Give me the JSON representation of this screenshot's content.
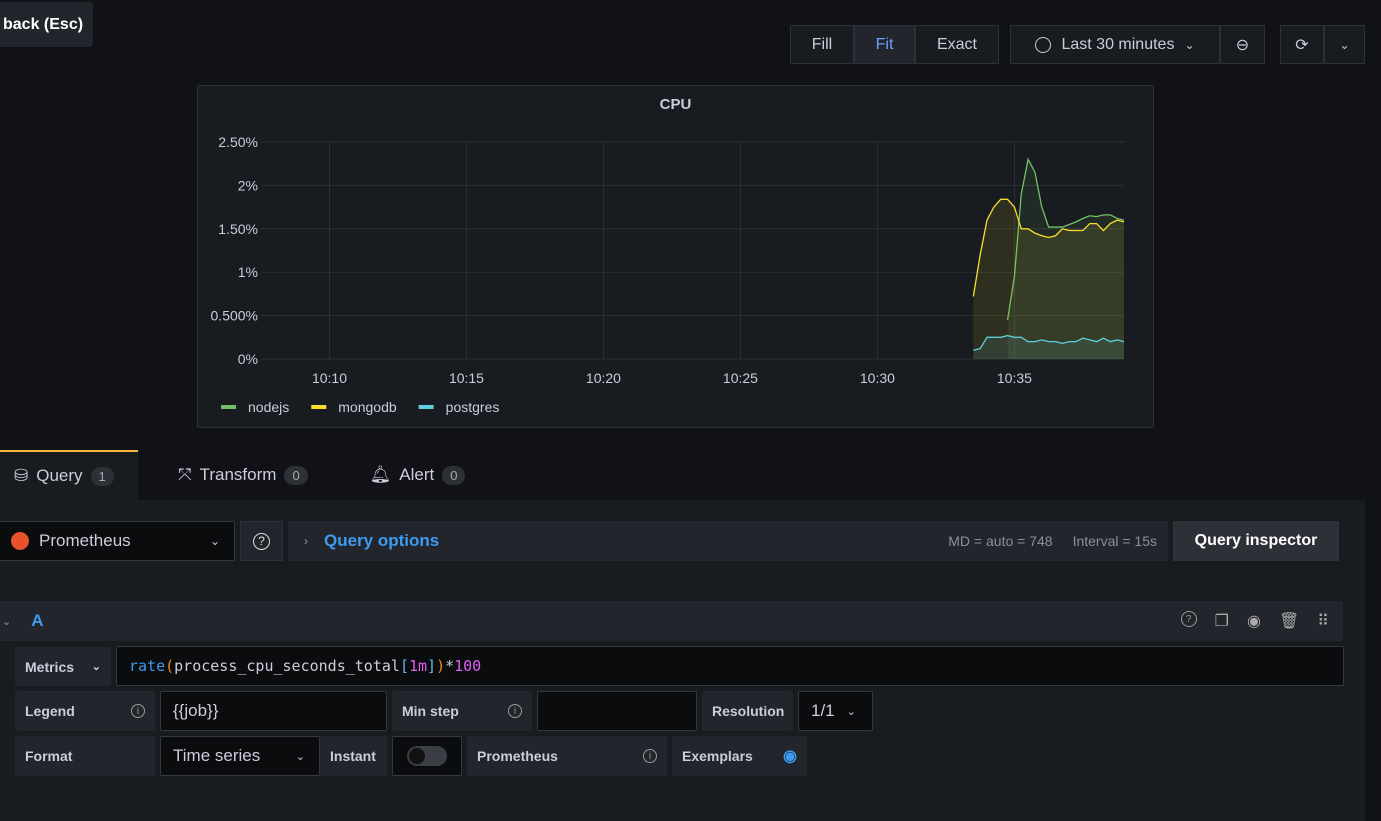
{
  "tooltip": "back (Esc)",
  "toolbar": {
    "fill": "Fill",
    "fit": "Fit",
    "exact": "Exact",
    "time_range": "Last 30 minutes"
  },
  "chart_data": {
    "type": "line",
    "title": "CPU",
    "yticks": [
      "0%",
      "0.500%",
      "1%",
      "1.50%",
      "2%",
      "2.50%"
    ],
    "ylim": [
      0,
      2.5
    ],
    "xticks": [
      "10:10",
      "10:15",
      "10:20",
      "10:25",
      "10:30",
      "10:35"
    ],
    "xlim": [
      "10:07:30",
      "10:39:00"
    ],
    "grid": true,
    "legend": "bottom-left",
    "fill_area": true,
    "series": [
      {
        "name": "nodejs",
        "color": "#73bf69",
        "start": "10:34:45",
        "step_seconds": 15,
        "values": [
          0.45,
          0.95,
          1.9,
          2.3,
          2.15,
          1.75,
          1.52,
          1.52,
          1.52,
          1.55,
          1.58,
          1.62,
          1.65,
          1.64,
          1.66,
          1.66,
          1.62,
          1.6
        ]
      },
      {
        "name": "mongodb",
        "color": "#fade2a",
        "start": "10:33:30",
        "step_seconds": 15,
        "values": [
          0.72,
          1.2,
          1.6,
          1.75,
          1.84,
          1.84,
          1.75,
          1.5,
          1.5,
          1.45,
          1.42,
          1.4,
          1.42,
          1.5,
          1.48,
          1.48,
          1.48,
          1.56,
          1.56,
          1.48,
          1.56,
          1.6,
          1.58
        ]
      },
      {
        "name": "postgres",
        "color": "#5ecfe0",
        "start": "10:33:30",
        "step_seconds": 15,
        "values": [
          0.1,
          0.12,
          0.25,
          0.25,
          0.25,
          0.27,
          0.25,
          0.25,
          0.2,
          0.2,
          0.22,
          0.2,
          0.2,
          0.18,
          0.2,
          0.2,
          0.24,
          0.22,
          0.2,
          0.24,
          0.2,
          0.22,
          0.2
        ]
      }
    ]
  },
  "tabs": [
    {
      "label": "Query",
      "count": "1"
    },
    {
      "label": "Transform",
      "count": "0"
    },
    {
      "label": "Alert",
      "count": "0"
    }
  ],
  "datasource": {
    "name": "Prometheus",
    "query_options": "Query options",
    "md": "MD = auto = 748",
    "interval": "Interval = 15s",
    "inspector": "Query inspector"
  },
  "query": {
    "ref": "A",
    "metrics_label": "Metrics",
    "expr": {
      "fn": "rate",
      "open": "(",
      "metric": "process_cpu_seconds_total",
      "lb": "[",
      "range": "1m",
      "rb": "]",
      "close": ")",
      "op": "*",
      "num": "100"
    },
    "legend_label": "Legend",
    "legend_value": "{{job}}",
    "minstep_label": "Min step",
    "minstep_value": "",
    "resolution_label": "Resolution",
    "resolution_value": "1/1",
    "format_label": "Format",
    "format_value": "Time series",
    "instant_label": "Instant",
    "instant_on": false,
    "prom_label": "Prometheus",
    "exemplars_label": "Exemplars"
  }
}
